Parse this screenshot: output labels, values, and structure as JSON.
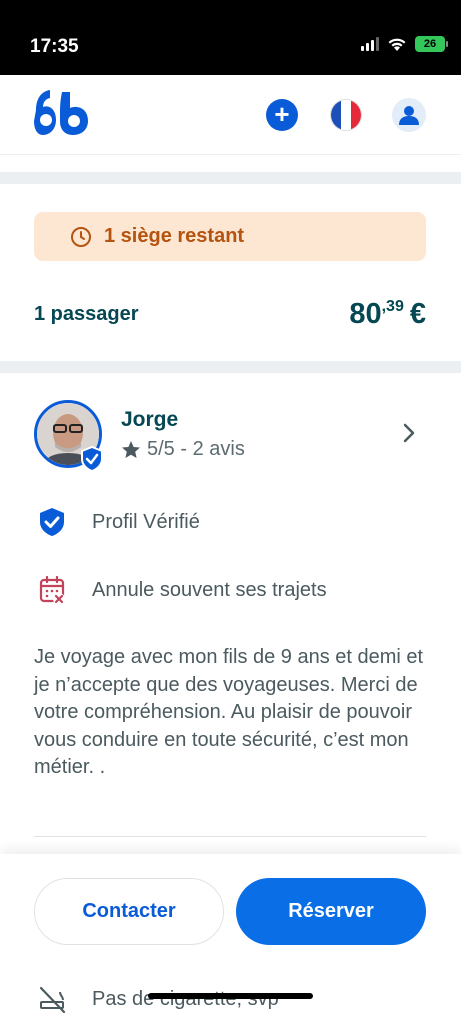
{
  "status_bar": {
    "time": "17:35",
    "battery": "26"
  },
  "header": {
    "logo": "blablacar-logo",
    "actions": [
      "add-ride",
      "language-fr",
      "profile"
    ]
  },
  "alert": {
    "text": "1 siège restant"
  },
  "booking": {
    "passengers": "1 passager",
    "price_main": "80",
    "price_cents": ",39",
    "currency": "€"
  },
  "driver": {
    "name": "Jorge",
    "rating": "5/5 - 2 avis"
  },
  "features": [
    {
      "label": "Profil Vérifié",
      "icon": "verified-shield-icon"
    },
    {
      "label": "Annule souvent ses trajets",
      "icon": "calendar-cancel-icon"
    }
  ],
  "bio": "Je voyage avec mon fils de 9 ans et demi et je n’accepte que des voyageuses. Merci de votre compréhension. Au plaisir de pouvoir vous conduire en toute sécurité, c’est mon métier. .",
  "actions": {
    "contact": "Contacter",
    "reserve": "Réserver"
  },
  "peek": {
    "label": "Pas de cigarette, svp"
  },
  "colors": {
    "primary": "#0a6fe6",
    "text": "#054752",
    "alert_bg": "#fde6d2",
    "alert_text": "#b55410"
  }
}
